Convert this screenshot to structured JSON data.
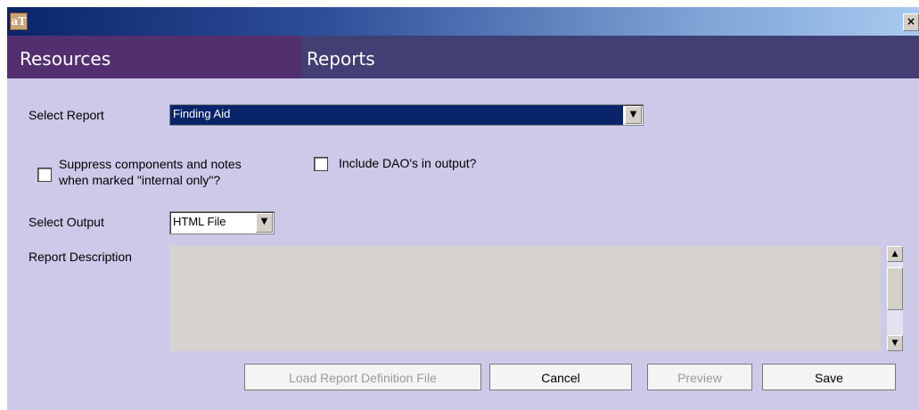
{
  "titlebar": {
    "app_icon_text": "aT",
    "close_glyph": "×"
  },
  "header": {
    "left_title": "Resources",
    "right_title": "Reports"
  },
  "form": {
    "select_report_label": "Select Report",
    "select_report_value": "Finding Aid",
    "suppress_label_line1": "Suppress components and notes",
    "suppress_label_line2": "when marked \"internal only\"?",
    "suppress_checked": false,
    "include_dao_label": "Include DAO's in output?",
    "include_dao_checked": false,
    "select_output_label": "Select Output",
    "select_output_value": "HTML File",
    "report_description_label": "Report Description",
    "report_description_value": ""
  },
  "buttons": {
    "load_report": "Load Report Definition File",
    "cancel": "Cancel",
    "preview": "Preview",
    "save": "Save"
  },
  "icons": {
    "dropdown": "chevron-down-icon",
    "scroll_up": "arrow-up-icon",
    "scroll_down": "arrow-down-icon"
  }
}
